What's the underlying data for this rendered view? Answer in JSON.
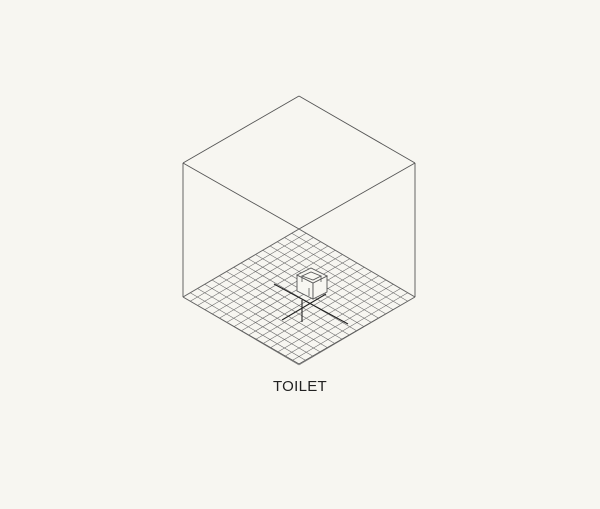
{
  "caption": "TOILET",
  "colors": {
    "paper": "#f7f6f1",
    "line": "#555555",
    "grid": "#6a6a6a",
    "text": "#222222"
  },
  "floor_grid": {
    "divisions": 16
  }
}
